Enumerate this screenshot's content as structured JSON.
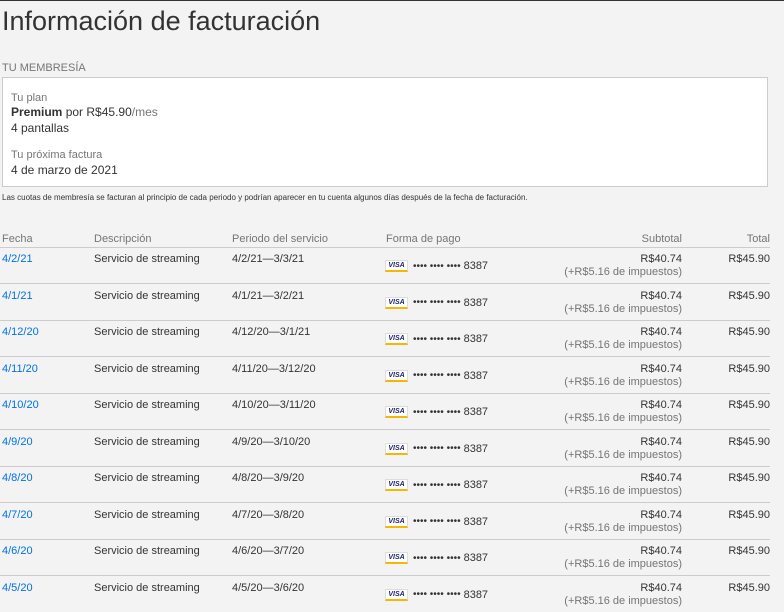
{
  "page": {
    "title": "Información de facturación",
    "section_label": "TU MEMBRESÍA"
  },
  "membership": {
    "plan_label": "Tu plan",
    "plan_name": "Premium",
    "plan_price_prefix": "por",
    "plan_price": "R$45.90",
    "plan_period": "/mes",
    "plan_screens": "4 pantallas",
    "next_bill_label": "Tu próxima factura",
    "next_bill_date": "4 de marzo de 2021"
  },
  "disclaimer": "Las cuotas de membresía se facturan al principio de cada periodo y podrían aparecer en tu cuenta algunos días después de la fecha de facturación.",
  "table": {
    "headers": {
      "date": "Fecha",
      "description": "Descripción",
      "period": "Periodo del servicio",
      "payment": "Forma de pago",
      "subtotal": "Subtotal",
      "total": "Total"
    },
    "rows": [
      {
        "date": "4/2/21",
        "description": "Servicio de streaming",
        "period": "4/2/21—3/3/21",
        "card_brand": "VISA",
        "card_mask": "•••• •••• ••••",
        "card_last4": "8387",
        "subtotal": "R$40.74",
        "tax": "(+R$5.16 de impuestos)",
        "total": "R$45.90"
      },
      {
        "date": "4/1/21",
        "description": "Servicio de streaming",
        "period": "4/1/21—3/2/21",
        "card_brand": "VISA",
        "card_mask": "•••• •••• ••••",
        "card_last4": "8387",
        "subtotal": "R$40.74",
        "tax": "(+R$5.16 de impuestos)",
        "total": "R$45.90"
      },
      {
        "date": "4/12/20",
        "description": "Servicio de streaming",
        "period": "4/12/20—3/1/21",
        "card_brand": "VISA",
        "card_mask": "•••• •••• ••••",
        "card_last4": "8387",
        "subtotal": "R$40.74",
        "tax": "(+R$5.16 de impuestos)",
        "total": "R$45.90"
      },
      {
        "date": "4/11/20",
        "description": "Servicio de streaming",
        "period": "4/11/20—3/12/20",
        "card_brand": "VISA",
        "card_mask": "•••• •••• ••••",
        "card_last4": "8387",
        "subtotal": "R$40.74",
        "tax": "(+R$5.16 de impuestos)",
        "total": "R$45.90"
      },
      {
        "date": "4/10/20",
        "description": "Servicio de streaming",
        "period": "4/10/20—3/11/20",
        "card_brand": "VISA",
        "card_mask": "•••• •••• ••••",
        "card_last4": "8387",
        "subtotal": "R$40.74",
        "tax": "(+R$5.16 de impuestos)",
        "total": "R$45.90"
      },
      {
        "date": "4/9/20",
        "description": "Servicio de streaming",
        "period": "4/9/20—3/10/20",
        "card_brand": "VISA",
        "card_mask": "•••• •••• ••••",
        "card_last4": "8387",
        "subtotal": "R$40.74",
        "tax": "(+R$5.16 de impuestos)",
        "total": "R$45.90"
      },
      {
        "date": "4/8/20",
        "description": "Servicio de streaming",
        "period": "4/8/20—3/9/20",
        "card_brand": "VISA",
        "card_mask": "•••• •••• ••••",
        "card_last4": "8387",
        "subtotal": "R$40.74",
        "tax": "(+R$5.16 de impuestos)",
        "total": "R$45.90"
      },
      {
        "date": "4/7/20",
        "description": "Servicio de streaming",
        "period": "4/7/20—3/8/20",
        "card_brand": "VISA",
        "card_mask": "•••• •••• ••••",
        "card_last4": "8387",
        "subtotal": "R$40.74",
        "tax": "(+R$5.16 de impuestos)",
        "total": "R$45.90"
      },
      {
        "date": "4/6/20",
        "description": "Servicio de streaming",
        "period": "4/6/20—3/7/20",
        "card_brand": "VISA",
        "card_mask": "•••• •••• ••••",
        "card_last4": "8387",
        "subtotal": "R$40.74",
        "tax": "(+R$5.16 de impuestos)",
        "total": "R$45.90"
      },
      {
        "date": "4/5/20",
        "description": "Servicio de streaming",
        "period": "4/5/20—3/6/20",
        "card_brand": "VISA",
        "card_mask": "•••• •••• ••••",
        "card_last4": "8387",
        "subtotal": "R$40.74",
        "tax": "(+R$5.16 de impuestos)",
        "total": "R$45.90"
      }
    ]
  },
  "colors": {
    "link": "#0071eb",
    "background": "#f3f3f3",
    "text": "#333333",
    "muted": "#757575"
  }
}
